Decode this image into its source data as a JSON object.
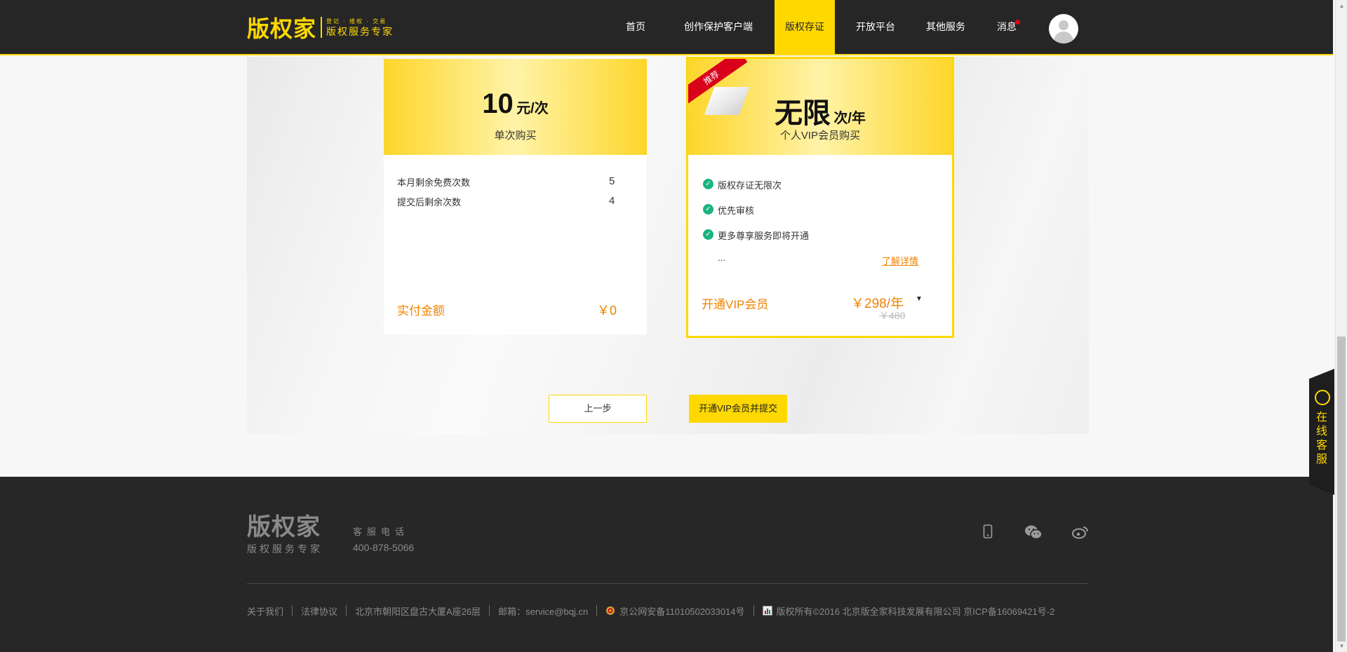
{
  "header": {
    "logo_main": "版权家",
    "logo_tagline": "登记 · 维权 · 交易",
    "logo_sub": "版权服务专家",
    "nav": [
      {
        "label": "首页"
      },
      {
        "label": "创作保护客户端"
      },
      {
        "label": "版权存证",
        "active": true
      },
      {
        "label": "开放平台"
      },
      {
        "label": "其他服务"
      },
      {
        "label": "消息",
        "dot_color": "#e60012"
      }
    ]
  },
  "single": {
    "price": "10",
    "unit": "元/次",
    "title": "单次购买",
    "rows": [
      {
        "label": "本月剩余免费次数",
        "value": "5"
      },
      {
        "label": "提交后剩余次数",
        "value": "4"
      }
    ],
    "pay_label": "实付金额",
    "pay_value": "￥0"
  },
  "vip": {
    "ribbon": "推荐",
    "price": "无限",
    "unit": "次/年",
    "title": "个人VIP会员购买",
    "features": [
      "版权存证无限次",
      "优先审核",
      "更多尊享服务即将开通"
    ],
    "ellipsis": "...",
    "detail_link": "了解详情",
    "open_label": "开通VIP会员",
    "price_year": "￥298/年",
    "original_price": "￥480"
  },
  "buttons": {
    "prev": "上一步",
    "submit": "开通VIP会员并提交"
  },
  "footer": {
    "logo_main": "版权家",
    "logo_sub": "版权服务专家",
    "phone_label": "客服电话",
    "phone": "400-878-5066",
    "links": [
      "关于我们",
      "法律协议",
      "北京市朝阳区盘古大厦A座26层",
      "邮箱：service@bqj.cn",
      "京公网安备11010502033014号",
      "版权所有©2016  北京版全家科技发展有限公司  京ICP备16069421号-2"
    ]
  },
  "side_service": "在线客服",
  "colors": {
    "accent": "#ffd800",
    "orange": "#f08300",
    "check": "#1bb37f",
    "dark": "#262626"
  }
}
